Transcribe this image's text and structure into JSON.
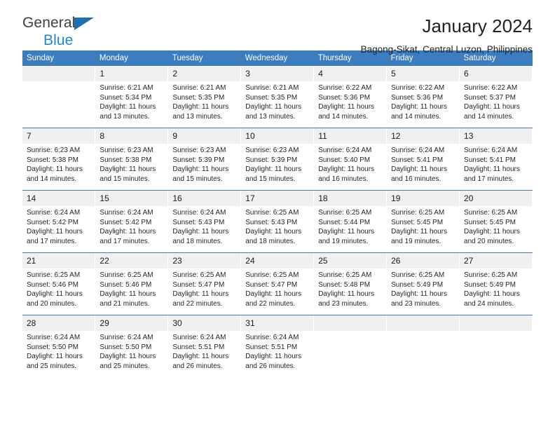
{
  "brand": {
    "name_top": "General",
    "name_bottom": "Blue",
    "mark": "triangle-logo",
    "color_dark": "#3f3f3f",
    "color_blue": "#1f86d0"
  },
  "header": {
    "title": "January 2024",
    "subtitle": "Bagong-Sikat, Central Luzon, Philippines"
  },
  "theme": {
    "header_bg": "#3b7dbf",
    "header_text": "#ffffff",
    "daynum_bg": "#f0f0f0",
    "cell_bg": "#ffffff",
    "rule": "#3b7dbf"
  },
  "weekdays": [
    "Sunday",
    "Monday",
    "Tuesday",
    "Wednesday",
    "Thursday",
    "Friday",
    "Saturday"
  ],
  "labels": {
    "sunrise_prefix": "Sunrise:",
    "sunset_prefix": "Sunset:",
    "daylight_prefix": "Daylight:"
  },
  "weeks": [
    [
      {
        "day": "",
        "l1": "",
        "l2": "",
        "l3": "",
        "l4": ""
      },
      {
        "day": "1",
        "l1": "Sunrise: 6:21 AM",
        "l2": "Sunset: 5:34 PM",
        "l3": "Daylight: 11 hours",
        "l4": "and 13 minutes."
      },
      {
        "day": "2",
        "l1": "Sunrise: 6:21 AM",
        "l2": "Sunset: 5:35 PM",
        "l3": "Daylight: 11 hours",
        "l4": "and 13 minutes."
      },
      {
        "day": "3",
        "l1": "Sunrise: 6:21 AM",
        "l2": "Sunset: 5:35 PM",
        "l3": "Daylight: 11 hours",
        "l4": "and 13 minutes."
      },
      {
        "day": "4",
        "l1": "Sunrise: 6:22 AM",
        "l2": "Sunset: 5:36 PM",
        "l3": "Daylight: 11 hours",
        "l4": "and 14 minutes."
      },
      {
        "day": "5",
        "l1": "Sunrise: 6:22 AM",
        "l2": "Sunset: 5:36 PM",
        "l3": "Daylight: 11 hours",
        "l4": "and 14 minutes."
      },
      {
        "day": "6",
        "l1": "Sunrise: 6:22 AM",
        "l2": "Sunset: 5:37 PM",
        "l3": "Daylight: 11 hours",
        "l4": "and 14 minutes."
      }
    ],
    [
      {
        "day": "7",
        "l1": "Sunrise: 6:23 AM",
        "l2": "Sunset: 5:38 PM",
        "l3": "Daylight: 11 hours",
        "l4": "and 14 minutes."
      },
      {
        "day": "8",
        "l1": "Sunrise: 6:23 AM",
        "l2": "Sunset: 5:38 PM",
        "l3": "Daylight: 11 hours",
        "l4": "and 15 minutes."
      },
      {
        "day": "9",
        "l1": "Sunrise: 6:23 AM",
        "l2": "Sunset: 5:39 PM",
        "l3": "Daylight: 11 hours",
        "l4": "and 15 minutes."
      },
      {
        "day": "10",
        "l1": "Sunrise: 6:23 AM",
        "l2": "Sunset: 5:39 PM",
        "l3": "Daylight: 11 hours",
        "l4": "and 15 minutes."
      },
      {
        "day": "11",
        "l1": "Sunrise: 6:24 AM",
        "l2": "Sunset: 5:40 PM",
        "l3": "Daylight: 11 hours",
        "l4": "and 16 minutes."
      },
      {
        "day": "12",
        "l1": "Sunrise: 6:24 AM",
        "l2": "Sunset: 5:41 PM",
        "l3": "Daylight: 11 hours",
        "l4": "and 16 minutes."
      },
      {
        "day": "13",
        "l1": "Sunrise: 6:24 AM",
        "l2": "Sunset: 5:41 PM",
        "l3": "Daylight: 11 hours",
        "l4": "and 17 minutes."
      }
    ],
    [
      {
        "day": "14",
        "l1": "Sunrise: 6:24 AM",
        "l2": "Sunset: 5:42 PM",
        "l3": "Daylight: 11 hours",
        "l4": "and 17 minutes."
      },
      {
        "day": "15",
        "l1": "Sunrise: 6:24 AM",
        "l2": "Sunset: 5:42 PM",
        "l3": "Daylight: 11 hours",
        "l4": "and 17 minutes."
      },
      {
        "day": "16",
        "l1": "Sunrise: 6:24 AM",
        "l2": "Sunset: 5:43 PM",
        "l3": "Daylight: 11 hours",
        "l4": "and 18 minutes."
      },
      {
        "day": "17",
        "l1": "Sunrise: 6:25 AM",
        "l2": "Sunset: 5:43 PM",
        "l3": "Daylight: 11 hours",
        "l4": "and 18 minutes."
      },
      {
        "day": "18",
        "l1": "Sunrise: 6:25 AM",
        "l2": "Sunset: 5:44 PM",
        "l3": "Daylight: 11 hours",
        "l4": "and 19 minutes."
      },
      {
        "day": "19",
        "l1": "Sunrise: 6:25 AM",
        "l2": "Sunset: 5:45 PM",
        "l3": "Daylight: 11 hours",
        "l4": "and 19 minutes."
      },
      {
        "day": "20",
        "l1": "Sunrise: 6:25 AM",
        "l2": "Sunset: 5:45 PM",
        "l3": "Daylight: 11 hours",
        "l4": "and 20 minutes."
      }
    ],
    [
      {
        "day": "21",
        "l1": "Sunrise: 6:25 AM",
        "l2": "Sunset: 5:46 PM",
        "l3": "Daylight: 11 hours",
        "l4": "and 20 minutes."
      },
      {
        "day": "22",
        "l1": "Sunrise: 6:25 AM",
        "l2": "Sunset: 5:46 PM",
        "l3": "Daylight: 11 hours",
        "l4": "and 21 minutes."
      },
      {
        "day": "23",
        "l1": "Sunrise: 6:25 AM",
        "l2": "Sunset: 5:47 PM",
        "l3": "Daylight: 11 hours",
        "l4": "and 22 minutes."
      },
      {
        "day": "24",
        "l1": "Sunrise: 6:25 AM",
        "l2": "Sunset: 5:47 PM",
        "l3": "Daylight: 11 hours",
        "l4": "and 22 minutes."
      },
      {
        "day": "25",
        "l1": "Sunrise: 6:25 AM",
        "l2": "Sunset: 5:48 PM",
        "l3": "Daylight: 11 hours",
        "l4": "and 23 minutes."
      },
      {
        "day": "26",
        "l1": "Sunrise: 6:25 AM",
        "l2": "Sunset: 5:49 PM",
        "l3": "Daylight: 11 hours",
        "l4": "and 23 minutes."
      },
      {
        "day": "27",
        "l1": "Sunrise: 6:25 AM",
        "l2": "Sunset: 5:49 PM",
        "l3": "Daylight: 11 hours",
        "l4": "and 24 minutes."
      }
    ],
    [
      {
        "day": "28",
        "l1": "Sunrise: 6:24 AM",
        "l2": "Sunset: 5:50 PM",
        "l3": "Daylight: 11 hours",
        "l4": "and 25 minutes."
      },
      {
        "day": "29",
        "l1": "Sunrise: 6:24 AM",
        "l2": "Sunset: 5:50 PM",
        "l3": "Daylight: 11 hours",
        "l4": "and 25 minutes."
      },
      {
        "day": "30",
        "l1": "Sunrise: 6:24 AM",
        "l2": "Sunset: 5:51 PM",
        "l3": "Daylight: 11 hours",
        "l4": "and 26 minutes."
      },
      {
        "day": "31",
        "l1": "Sunrise: 6:24 AM",
        "l2": "Sunset: 5:51 PM",
        "l3": "Daylight: 11 hours",
        "l4": "and 26 minutes."
      },
      {
        "day": "",
        "l1": "",
        "l2": "",
        "l3": "",
        "l4": ""
      },
      {
        "day": "",
        "l1": "",
        "l2": "",
        "l3": "",
        "l4": ""
      },
      {
        "day": "",
        "l1": "",
        "l2": "",
        "l3": "",
        "l4": ""
      }
    ]
  ]
}
